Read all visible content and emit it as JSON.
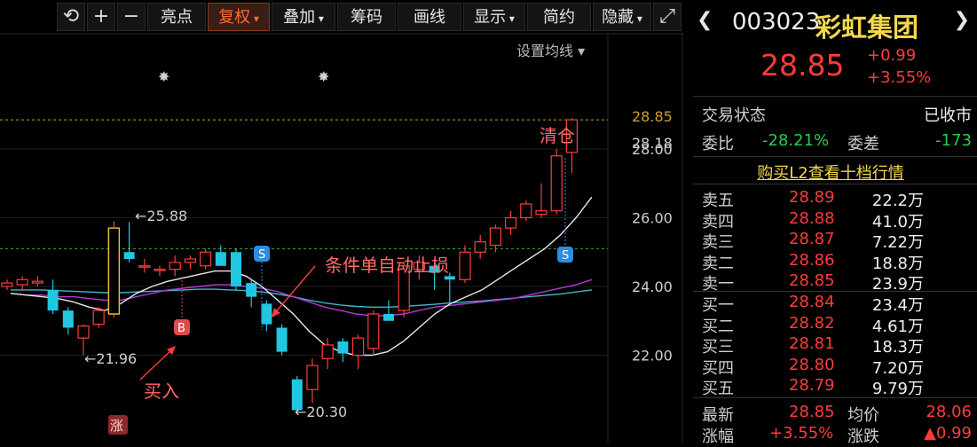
{
  "toolbar": {
    "items": [
      "亮点",
      "复权",
      "叠加",
      "筹码",
      "画线",
      "显示",
      "简约",
      "隐藏"
    ],
    "active": "复权",
    "set_ma": "设置均线 ▾"
  },
  "quote": {
    "code": "003023",
    "name": "彩虹集团",
    "price": "28.85",
    "change": "+0.99",
    "change_pct": "+3.55%"
  },
  "status": {
    "trade_label": "交易状态",
    "trade_value": "已收市",
    "webi_label": "委比",
    "webi_value": "-28.21%",
    "weicha_label": "委差",
    "weicha_value": "-173",
    "l2_link": "购买L2查看十档行情"
  },
  "orderbook": {
    "asks": [
      {
        "label": "卖五",
        "price": "28.89",
        "vol": "22.2万"
      },
      {
        "label": "卖四",
        "price": "28.88",
        "vol": "41.0万"
      },
      {
        "label": "卖三",
        "price": "28.87",
        "vol": "7.22万"
      },
      {
        "label": "卖二",
        "price": "28.86",
        "vol": "18.8万"
      },
      {
        "label": "卖一",
        "price": "28.85",
        "vol": "23.9万"
      }
    ],
    "bids": [
      {
        "label": "买一",
        "price": "28.84",
        "vol": "23.4万"
      },
      {
        "label": "买二",
        "price": "28.82",
        "vol": "4.61万"
      },
      {
        "label": "买三",
        "price": "28.81",
        "vol": "18.3万"
      },
      {
        "label": "买四",
        "price": "28.80",
        "vol": "7.20万"
      },
      {
        "label": "买五",
        "price": "28.79",
        "vol": "9.79万"
      }
    ]
  },
  "summary": {
    "latest_label": "最新",
    "latest_value": "28.85",
    "avg_label": "均价",
    "avg_value": "28.06",
    "pct_label": "涨幅",
    "pct_value": "+3.55%",
    "chg_label": "涨跌",
    "chg_value": "▲0.99"
  },
  "chart_data": {
    "type": "candlestick",
    "y_ticks": [
      "28.00",
      "26.00",
      "24.00",
      "22.00"
    ],
    "ylim": [
      20.0,
      30.0
    ],
    "last_price_tag": "28.85",
    "price_tag_2": "28.18",
    "high_annotation": "25.88",
    "low_annotation_1": "21.96",
    "low_annotation_2": "20.30",
    "buy_text": "买入",
    "stop_text": "条件单自动止损",
    "clear_text": "清仓",
    "buy_marker": "B",
    "sell_marker": "S",
    "limit_up_marker": "涨",
    "reference_line": 25.1,
    "candles": [
      {
        "o": 24.0,
        "h": 24.2,
        "l": 23.9,
        "c": 24.1
      },
      {
        "o": 24.05,
        "h": 24.3,
        "l": 23.9,
        "c": 24.2
      },
      {
        "o": 24.1,
        "h": 24.3,
        "l": 24.0,
        "c": 24.15
      },
      {
        "o": 23.9,
        "h": 24.2,
        "l": 23.2,
        "c": 23.3
      },
      {
        "o": 23.3,
        "h": 23.4,
        "l": 22.6,
        "c": 22.8
      },
      {
        "o": 22.5,
        "h": 22.9,
        "l": 22.0,
        "c": 22.85
      },
      {
        "o": 22.9,
        "h": 23.4,
        "l": 22.8,
        "c": 23.3
      },
      {
        "o": 23.2,
        "h": 25.9,
        "l": 23.1,
        "c": 25.7
      },
      {
        "o": 25.0,
        "h": 25.88,
        "l": 24.7,
        "c": 24.8
      },
      {
        "o": 24.6,
        "h": 24.8,
        "l": 24.4,
        "c": 24.6
      },
      {
        "o": 24.5,
        "h": 24.6,
        "l": 24.3,
        "c": 24.5
      },
      {
        "o": 24.5,
        "h": 24.9,
        "l": 24.3,
        "c": 24.7
      },
      {
        "o": 24.7,
        "h": 24.9,
        "l": 24.5,
        "c": 24.8
      },
      {
        "o": 24.6,
        "h": 25.1,
        "l": 24.5,
        "c": 25.0
      },
      {
        "o": 25.0,
        "h": 25.2,
        "l": 24.8,
        "c": 24.6
      },
      {
        "o": 25.0,
        "h": 25.1,
        "l": 23.9,
        "c": 24.0
      },
      {
        "o": 24.1,
        "h": 24.2,
        "l": 23.4,
        "c": 23.7
      },
      {
        "o": 23.5,
        "h": 23.6,
        "l": 22.7,
        "c": 22.9
      },
      {
        "o": 22.8,
        "h": 22.9,
        "l": 22.0,
        "c": 22.1
      },
      {
        "o": 21.3,
        "h": 21.4,
        "l": 20.3,
        "c": 20.4
      },
      {
        "o": 21.0,
        "h": 21.9,
        "l": 20.6,
        "c": 21.7
      },
      {
        "o": 21.9,
        "h": 22.5,
        "l": 21.6,
        "c": 22.3
      },
      {
        "o": 22.4,
        "h": 22.5,
        "l": 21.8,
        "c": 22.05
      },
      {
        "o": 22.0,
        "h": 22.6,
        "l": 21.6,
        "c": 22.5
      },
      {
        "o": 22.2,
        "h": 23.3,
        "l": 22.0,
        "c": 23.2
      },
      {
        "o": 23.2,
        "h": 23.6,
        "l": 23.0,
        "c": 23.0
      },
      {
        "o": 23.3,
        "h": 24.7,
        "l": 23.1,
        "c": 24.6
      },
      {
        "o": 24.5,
        "h": 24.9,
        "l": 24.2,
        "c": 24.7
      },
      {
        "o": 24.6,
        "h": 24.7,
        "l": 23.9,
        "c": 24.4
      },
      {
        "o": 24.3,
        "h": 24.4,
        "l": 23.5,
        "c": 24.2
      },
      {
        "o": 24.2,
        "h": 25.2,
        "l": 24.1,
        "c": 25.0
      },
      {
        "o": 25.0,
        "h": 25.5,
        "l": 24.8,
        "c": 25.3
      },
      {
        "o": 25.2,
        "h": 25.8,
        "l": 25.0,
        "c": 25.7
      },
      {
        "o": 25.7,
        "h": 26.2,
        "l": 25.5,
        "c": 26.0
      },
      {
        "o": 26.0,
        "h": 26.5,
        "l": 25.9,
        "c": 26.4
      },
      {
        "o": 26.1,
        "h": 27.0,
        "l": 26.0,
        "c": 26.2
      },
      {
        "o": 26.2,
        "h": 28.0,
        "l": 26.1,
        "c": 27.8
      },
      {
        "o": 27.9,
        "h": 28.9,
        "l": 27.3,
        "c": 28.85
      }
    ],
    "ma_white": [
      23.8,
      23.75,
      23.7,
      23.65,
      23.55,
      23.4,
      23.3,
      23.5,
      23.8,
      24.0,
      24.15,
      24.25,
      24.35,
      24.45,
      24.45,
      24.3,
      24.0,
      23.6,
      23.2,
      22.7,
      22.3,
      22.1,
      22.0,
      22.0,
      22.1,
      22.4,
      22.8,
      23.2,
      23.5,
      23.7,
      23.9,
      24.2,
      24.5,
      24.8,
      25.1,
      25.5,
      26.0,
      26.6
    ],
    "ma_purple": [
      23.8,
      23.75,
      23.75,
      23.7,
      23.7,
      23.65,
      23.6,
      23.6,
      23.7,
      23.8,
      23.9,
      23.95,
      24.0,
      24.05,
      24.05,
      24.0,
      23.95,
      23.85,
      23.7,
      23.55,
      23.4,
      23.3,
      23.2,
      23.15,
      23.15,
      23.2,
      23.3,
      23.4,
      23.45,
      23.5,
      23.55,
      23.6,
      23.65,
      23.75,
      23.85,
      23.95,
      24.05,
      24.2
    ],
    "ma_cyan": [
      23.9,
      23.9,
      23.9,
      23.88,
      23.86,
      23.84,
      23.82,
      23.82,
      23.84,
      23.86,
      23.88,
      23.9,
      23.92,
      23.92,
      23.9,
      23.88,
      23.84,
      23.78,
      23.7,
      23.6,
      23.52,
      23.46,
      23.42,
      23.4,
      23.4,
      23.42,
      23.45,
      23.48,
      23.52,
      23.55,
      23.58,
      23.62,
      23.66,
      23.7,
      23.74,
      23.78,
      23.84,
      23.9
    ]
  }
}
